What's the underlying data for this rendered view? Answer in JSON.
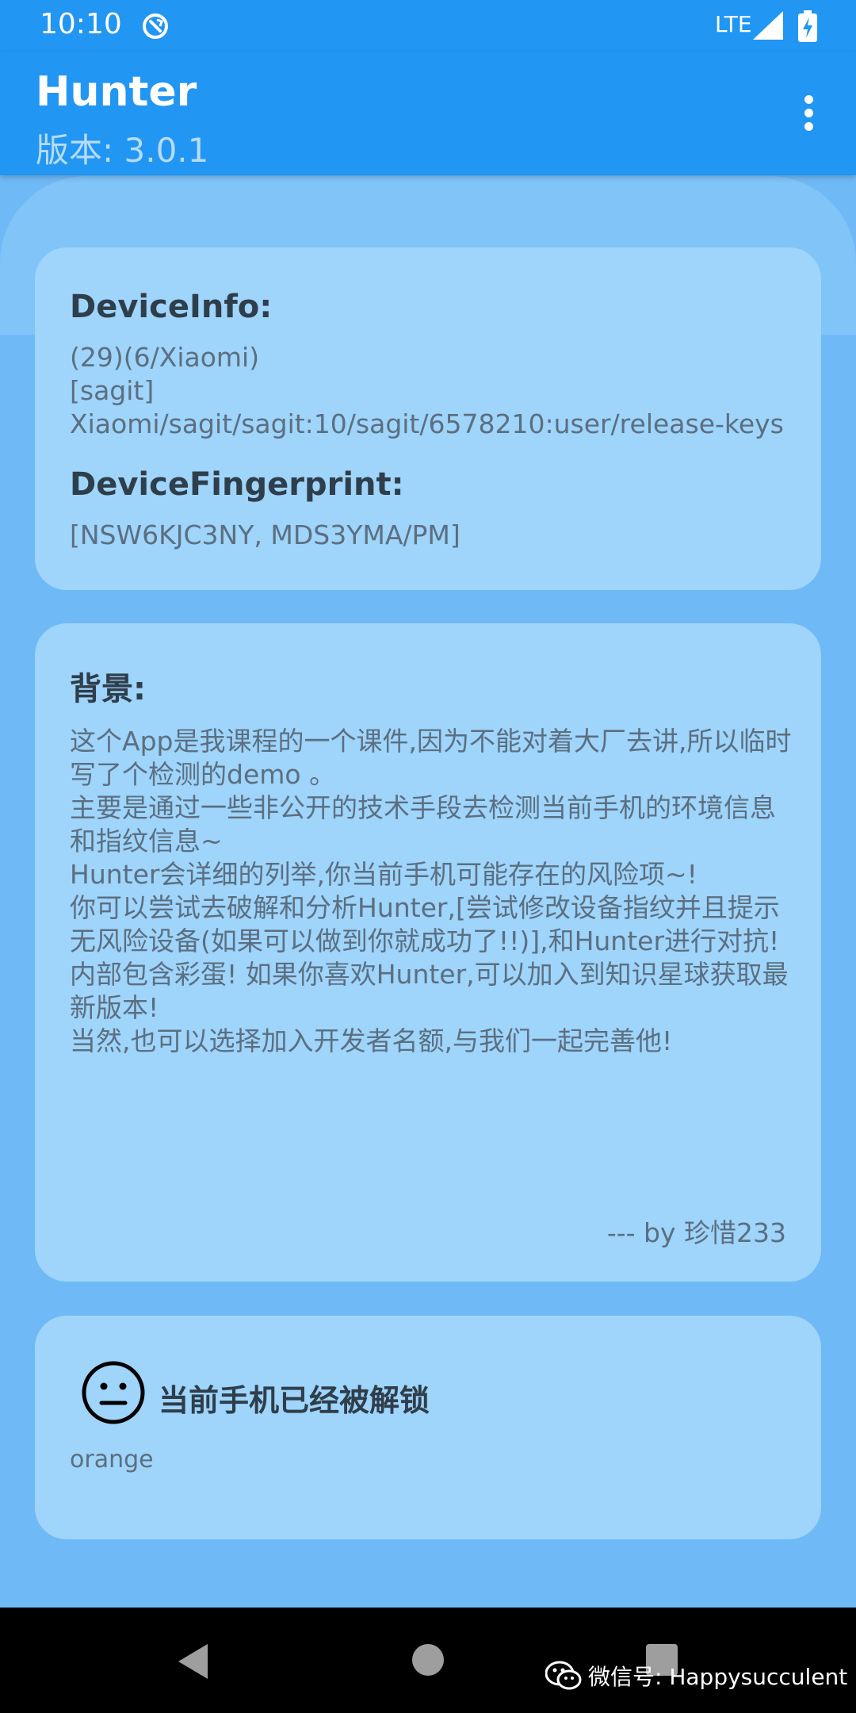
{
  "status_bar": {
    "time": "10:10",
    "network": "LTE",
    "icons": [
      "sync-icon",
      "signal-icon",
      "battery-charging-icon"
    ]
  },
  "app_bar": {
    "title": "Hunter",
    "subtitle": "版本: 3.0.1",
    "menu_icon": "more-vert-icon"
  },
  "device_card": {
    "info_heading": "DeviceInfo:",
    "info_lines": [
      "(29)(6/Xiaomi)",
      "[sagit]",
      "Xiaomi/sagit/sagit:10/sagit/6578210:user/release-keys"
    ],
    "fingerprint_heading": "DeviceFingerprint:",
    "fingerprint_value": "[NSW6KJC3NY, MDS3YMA/PM]"
  },
  "background_card": {
    "heading": "背景:",
    "paragraphs": [
      "这个App是我课程的一个课件,因为不能对着大厂去讲,所以临时写了个检测的demo 。",
      "主要是通过一些非公开的技术手段去检测当前手机的环境信息和指纹信息~",
      " Hunter会详细的列举,你当前手机可能存在的风险项~!",
      "你可以尝试去破解和分析Hunter,[尝试修改设备指纹并且提示无风险设备(如果可以做到你就成功了!!)],和Hunter进行对抗!",
      "内部包含彩蛋! 如果你喜欢Hunter,可以加入到知识星球获取最新版本!",
      "当然,也可以选择加入开发者名额,与我们一起完善他!"
    ],
    "signature": "--- by 珍惜233"
  },
  "status_card": {
    "icon": "neutral-face-icon",
    "message": "当前手机已经被解锁",
    "detail": "orange"
  },
  "nav_bar": {
    "icons": [
      "back-icon",
      "home-icon",
      "recents-icon"
    ]
  },
  "watermark": {
    "icon": "wechat-icon",
    "text": "微信号: Happysucculent"
  },
  "colors": {
    "primary": "#2196f3",
    "background": "#6fbaf6",
    "card": "#9fd4fb",
    "heading_text": "#2f3e4b",
    "body_text": "#5b6f80"
  }
}
